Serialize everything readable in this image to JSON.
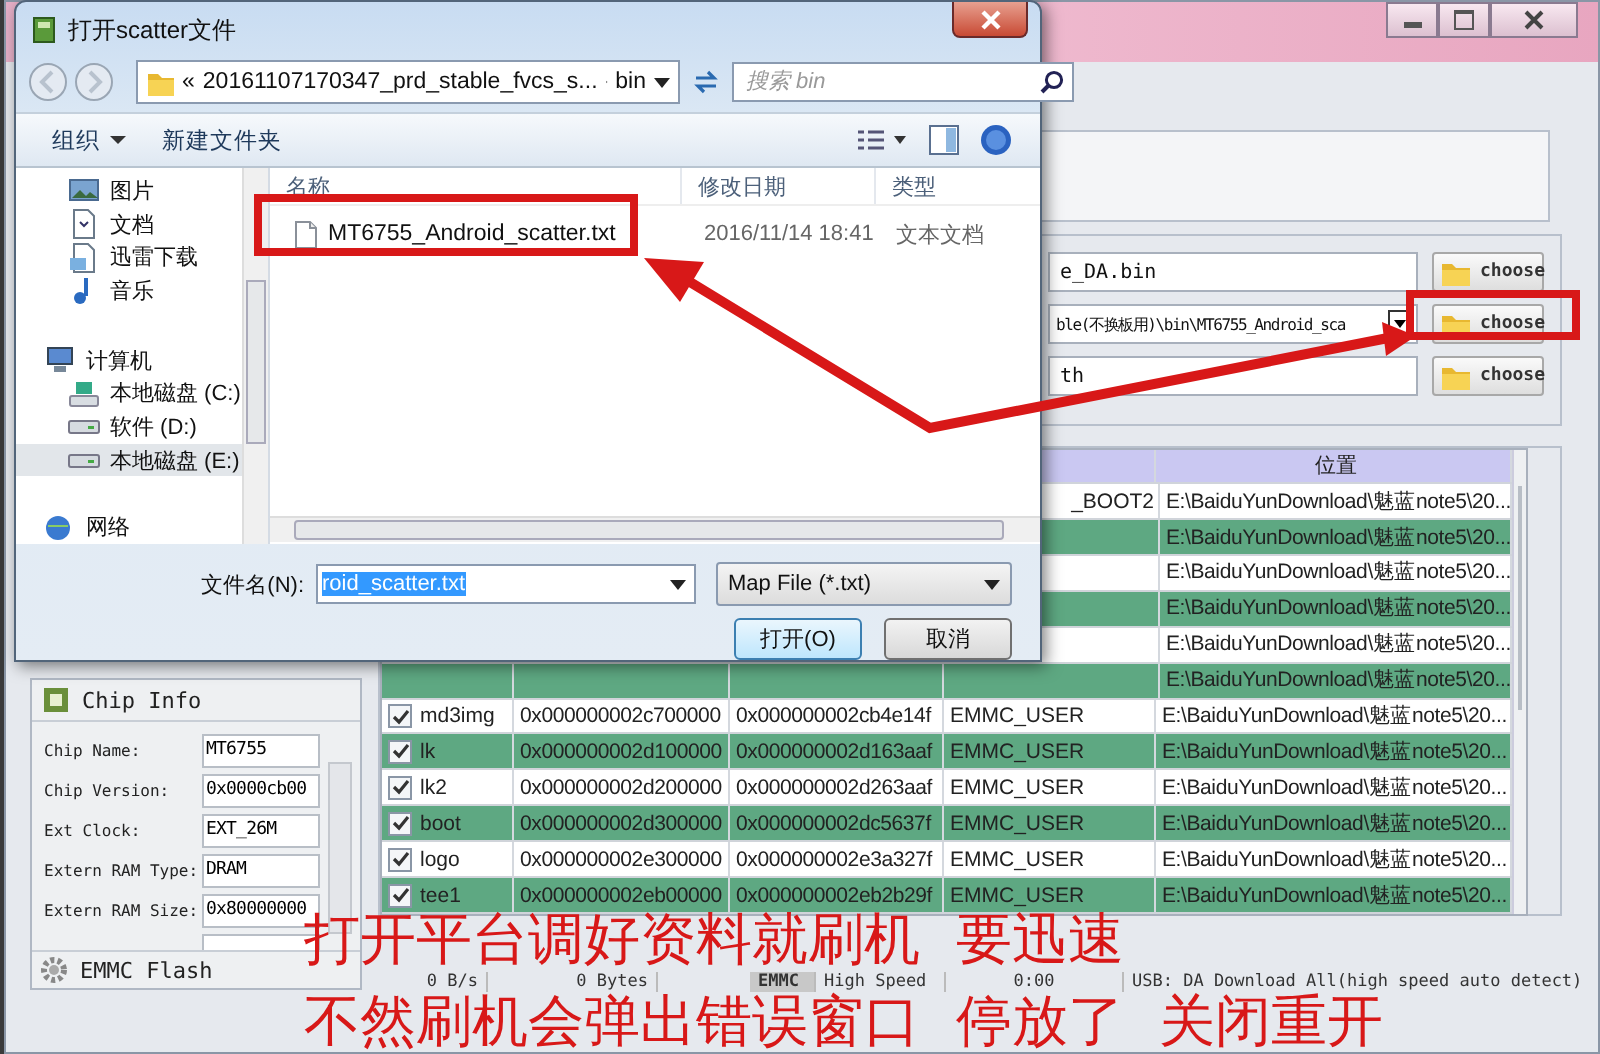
{
  "download_panel": {
    "fields": [
      {
        "value": "e_DA.bin",
        "dropdown": false,
        "button": "choose"
      },
      {
        "value": "ble(不换板用)\\bin\\MT6755_Android_sca",
        "dropdown": true,
        "button": "choose"
      },
      {
        "value": "th",
        "dropdown": false,
        "button": "choose"
      }
    ]
  },
  "table": {
    "location_header": "位置",
    "rows": [
      {
        "region": "_BOOT2",
        "location": "E:\\BaiduYunDownload\\魅蓝note5\\20..."
      },
      {
        "location": "E:\\BaiduYunDownload\\魅蓝note5\\20..."
      },
      {
        "location": "E:\\BaiduYunDownload\\魅蓝note5\\20..."
      },
      {
        "location": "E:\\BaiduYunDownload\\魅蓝note5\\20..."
      },
      {
        "location": "E:\\BaiduYunDownload\\魅蓝note5\\20..."
      },
      {
        "location": "E:\\BaiduYunDownload\\魅蓝note5\\20..."
      },
      {
        "checked": true,
        "name": "md3img",
        "begin": "0x000000002c700000",
        "end": "0x000000002cb4e14f",
        "region": "EMMC_USER",
        "location": "E:\\BaiduYunDownload\\魅蓝note5\\20..."
      },
      {
        "checked": true,
        "name": "lk",
        "begin": "0x000000002d100000",
        "end": "0x000000002d163aaf",
        "region": "EMMC_USER",
        "location": "E:\\BaiduYunDownload\\魅蓝note5\\20..."
      },
      {
        "checked": true,
        "name": "lk2",
        "begin": "0x000000002d200000",
        "end": "0x000000002d263aaf",
        "region": "EMMC_USER",
        "location": "E:\\BaiduYunDownload\\魅蓝note5\\20..."
      },
      {
        "checked": true,
        "name": "boot",
        "begin": "0x000000002d300000",
        "end": "0x000000002dc5637f",
        "region": "EMMC_USER",
        "location": "E:\\BaiduYunDownload\\魅蓝note5\\20..."
      },
      {
        "checked": true,
        "name": "logo",
        "begin": "0x000000002e300000",
        "end": "0x000000002e3a327f",
        "region": "EMMC_USER",
        "location": "E:\\BaiduYunDownload\\魅蓝note5\\20..."
      },
      {
        "checked": true,
        "name": "tee1",
        "begin": "0x000000002eb00000",
        "end": "0x000000002eb2b29f",
        "region": "EMMC_USER",
        "location": "E:\\BaiduYunDownload\\魅蓝note5\\20..."
      }
    ]
  },
  "chip_info": {
    "title": "Chip Info",
    "rows": [
      {
        "label": "Chip Name:",
        "value": "MT6755"
      },
      {
        "label": "Chip Version:",
        "value": "0x0000cb00"
      },
      {
        "label": "Ext Clock:",
        "value": "EXT_26M"
      },
      {
        "label": "Extern RAM Type:",
        "value": "DRAM"
      },
      {
        "label": "Extern RAM Size:",
        "value": "0x80000000"
      }
    ],
    "footer": "EMMC Flash"
  },
  "status_bar": [
    "0 B/s",
    "0 Bytes",
    "EMMC",
    "High Speed",
    "0:00",
    "USB: DA Download All(high speed auto detect)"
  ],
  "dialog": {
    "title": "打开scatter文件",
    "path": [
      "«",
      "20161107170347_prd_stable_fvcs_s...",
      "bin"
    ],
    "search": {
      "placeholder": "搜索 bin"
    },
    "toolbar": [
      "组织",
      "新建文件夹"
    ],
    "nav": [
      {
        "label": "图片",
        "kind": "pictures",
        "selected": false
      },
      {
        "label": "文档",
        "kind": "documents",
        "selected": false
      },
      {
        "label": "迅雷下载",
        "kind": "downloads",
        "selected": false
      },
      {
        "label": "音乐",
        "kind": "music",
        "selected": false
      },
      {
        "label": "计算机",
        "kind": "computer",
        "selected": false,
        "children": [
          {
            "label": "本地磁盘 (C:)",
            "kind": "system-drive",
            "selected": false
          },
          {
            "label": "软件 (D:)",
            "kind": "drive",
            "selected": false
          },
          {
            "label": "本地磁盘 (E:)",
            "kind": "drive",
            "selected": true
          }
        ]
      },
      {
        "label": "网络",
        "kind": "network",
        "selected": false
      }
    ],
    "columns": [
      "名称",
      "修改日期",
      "类型"
    ],
    "files": [
      {
        "name": "MT6755_Android_scatter.txt",
        "date": "2016/11/14 18:41",
        "type": "文本文档"
      }
    ],
    "filename_label": "文件名(N):",
    "filename": "roid_scatter.txt",
    "filter": "Map File (*.txt)",
    "buttons": [
      "打开(O)",
      "取消"
    ]
  },
  "annotation": {
    "lines": [
      "打开平台调好资料就刷机  要迅速",
      "不然刷机会弹出错误窗口  停放了  关闭重开"
    ]
  }
}
